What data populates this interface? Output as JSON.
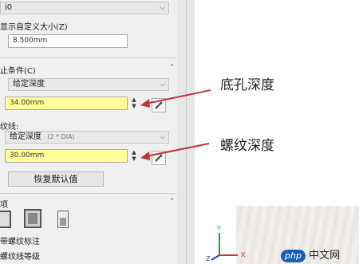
{
  "top_combo": {
    "value": "i0"
  },
  "custom_size": {
    "label": "显示自定义大小(Z)",
    "value": "8.500mm"
  },
  "end_condition": {
    "title": "止条件(C)",
    "type_value": "给定深度",
    "depth_value": "34.00mm"
  },
  "thread": {
    "title": "纹线:",
    "type_value": "给定深度",
    "type_hint": "(2 * DIA)",
    "depth_value": "30.00mm"
  },
  "restore_button": {
    "label": "恢复默认值"
  },
  "options": {
    "title": "项",
    "cosmetic_label": "带螺纹标注",
    "class_label": "螺纹线等级"
  },
  "annotations": {
    "hole_depth": "底孔深度",
    "thread_depth": "螺纹深度"
  },
  "axis": {
    "x_label": "X",
    "y_label": "Y",
    "z_label": "Z"
  },
  "watermark": {
    "brand": "php",
    "site": "中文网"
  },
  "colors": {
    "input_highlight": "#ffff99",
    "arrow": "#c0323a",
    "panel_bg": "#f0f0f0",
    "axis_x": "#d03030",
    "axis_y": "#2a9a2a",
    "axis_z": "#2040c0"
  }
}
